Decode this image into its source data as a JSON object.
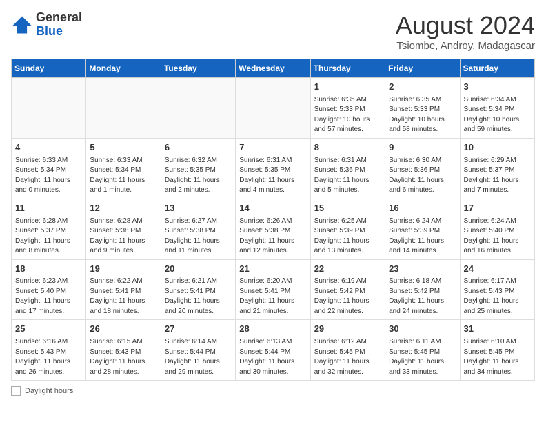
{
  "header": {
    "logo_general": "General",
    "logo_blue": "Blue",
    "month_title": "August 2024",
    "subtitle": "Tsiombe, Androy, Madagascar"
  },
  "days_of_week": [
    "Sunday",
    "Monday",
    "Tuesday",
    "Wednesday",
    "Thursday",
    "Friday",
    "Saturday"
  ],
  "weeks": [
    [
      {
        "day": "",
        "info": ""
      },
      {
        "day": "",
        "info": ""
      },
      {
        "day": "",
        "info": ""
      },
      {
        "day": "",
        "info": ""
      },
      {
        "day": "1",
        "info": "Sunrise: 6:35 AM\nSunset: 5:33 PM\nDaylight: 10 hours and 57 minutes."
      },
      {
        "day": "2",
        "info": "Sunrise: 6:35 AM\nSunset: 5:33 PM\nDaylight: 10 hours and 58 minutes."
      },
      {
        "day": "3",
        "info": "Sunrise: 6:34 AM\nSunset: 5:34 PM\nDaylight: 10 hours and 59 minutes."
      }
    ],
    [
      {
        "day": "4",
        "info": "Sunrise: 6:33 AM\nSunset: 5:34 PM\nDaylight: 11 hours and 0 minutes."
      },
      {
        "day": "5",
        "info": "Sunrise: 6:33 AM\nSunset: 5:34 PM\nDaylight: 11 hours and 1 minute."
      },
      {
        "day": "6",
        "info": "Sunrise: 6:32 AM\nSunset: 5:35 PM\nDaylight: 11 hours and 2 minutes."
      },
      {
        "day": "7",
        "info": "Sunrise: 6:31 AM\nSunset: 5:35 PM\nDaylight: 11 hours and 4 minutes."
      },
      {
        "day": "8",
        "info": "Sunrise: 6:31 AM\nSunset: 5:36 PM\nDaylight: 11 hours and 5 minutes."
      },
      {
        "day": "9",
        "info": "Sunrise: 6:30 AM\nSunset: 5:36 PM\nDaylight: 11 hours and 6 minutes."
      },
      {
        "day": "10",
        "info": "Sunrise: 6:29 AM\nSunset: 5:37 PM\nDaylight: 11 hours and 7 minutes."
      }
    ],
    [
      {
        "day": "11",
        "info": "Sunrise: 6:28 AM\nSunset: 5:37 PM\nDaylight: 11 hours and 8 minutes."
      },
      {
        "day": "12",
        "info": "Sunrise: 6:28 AM\nSunset: 5:38 PM\nDaylight: 11 hours and 9 minutes."
      },
      {
        "day": "13",
        "info": "Sunrise: 6:27 AM\nSunset: 5:38 PM\nDaylight: 11 hours and 11 minutes."
      },
      {
        "day": "14",
        "info": "Sunrise: 6:26 AM\nSunset: 5:38 PM\nDaylight: 11 hours and 12 minutes."
      },
      {
        "day": "15",
        "info": "Sunrise: 6:25 AM\nSunset: 5:39 PM\nDaylight: 11 hours and 13 minutes."
      },
      {
        "day": "16",
        "info": "Sunrise: 6:24 AM\nSunset: 5:39 PM\nDaylight: 11 hours and 14 minutes."
      },
      {
        "day": "17",
        "info": "Sunrise: 6:24 AM\nSunset: 5:40 PM\nDaylight: 11 hours and 16 minutes."
      }
    ],
    [
      {
        "day": "18",
        "info": "Sunrise: 6:23 AM\nSunset: 5:40 PM\nDaylight: 11 hours and 17 minutes."
      },
      {
        "day": "19",
        "info": "Sunrise: 6:22 AM\nSunset: 5:41 PM\nDaylight: 11 hours and 18 minutes."
      },
      {
        "day": "20",
        "info": "Sunrise: 6:21 AM\nSunset: 5:41 PM\nDaylight: 11 hours and 20 minutes."
      },
      {
        "day": "21",
        "info": "Sunrise: 6:20 AM\nSunset: 5:41 PM\nDaylight: 11 hours and 21 minutes."
      },
      {
        "day": "22",
        "info": "Sunrise: 6:19 AM\nSunset: 5:42 PM\nDaylight: 11 hours and 22 minutes."
      },
      {
        "day": "23",
        "info": "Sunrise: 6:18 AM\nSunset: 5:42 PM\nDaylight: 11 hours and 24 minutes."
      },
      {
        "day": "24",
        "info": "Sunrise: 6:17 AM\nSunset: 5:43 PM\nDaylight: 11 hours and 25 minutes."
      }
    ],
    [
      {
        "day": "25",
        "info": "Sunrise: 6:16 AM\nSunset: 5:43 PM\nDaylight: 11 hours and 26 minutes."
      },
      {
        "day": "26",
        "info": "Sunrise: 6:15 AM\nSunset: 5:43 PM\nDaylight: 11 hours and 28 minutes."
      },
      {
        "day": "27",
        "info": "Sunrise: 6:14 AM\nSunset: 5:44 PM\nDaylight: 11 hours and 29 minutes."
      },
      {
        "day": "28",
        "info": "Sunrise: 6:13 AM\nSunset: 5:44 PM\nDaylight: 11 hours and 30 minutes."
      },
      {
        "day": "29",
        "info": "Sunrise: 6:12 AM\nSunset: 5:45 PM\nDaylight: 11 hours and 32 minutes."
      },
      {
        "day": "30",
        "info": "Sunrise: 6:11 AM\nSunset: 5:45 PM\nDaylight: 11 hours and 33 minutes."
      },
      {
        "day": "31",
        "info": "Sunrise: 6:10 AM\nSunset: 5:45 PM\nDaylight: 11 hours and 34 minutes."
      }
    ]
  ],
  "footer": {
    "label": "Daylight hours"
  }
}
